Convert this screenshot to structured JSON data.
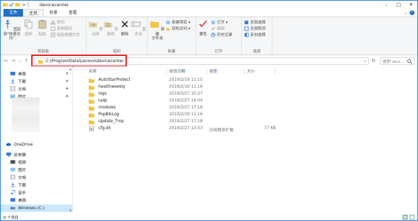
{
  "window": {
    "title": "devicecenter"
  },
  "tabs": [
    "文件",
    "主页",
    "共享",
    "查看"
  ],
  "ribbon": {
    "clipboard": {
      "label": "剪贴板",
      "pin": "固定到\"快速访问\"",
      "copy": "复制",
      "paste": "粘贴",
      "cut": "剪切",
      "copy_path": "复制路径",
      "paste_shortcut": "粘贴快捷方式"
    },
    "organize": {
      "label": "组织",
      "move_to": "移动到",
      "copy_to": "复制到",
      "delete": "删除",
      "rename": "重命名"
    },
    "new": {
      "label": "新建",
      "new_folder": "新建\n文件夹",
      "new_item": "新建项目 ▾",
      "easy_access": "轻松访问 ▾"
    },
    "open": {
      "label": "打开",
      "properties": "属性",
      "open": "打开 ▾",
      "edit": "编辑",
      "history": "历史记录"
    },
    "select": {
      "label": "选择",
      "select_all": "全部选择",
      "select_none": "全部取消",
      "invert": "反向选择"
    }
  },
  "address": {
    "path": "C:\\ProgramData\\Lenovo\\devicecenter",
    "search_placeholder": "搜索\"devi..."
  },
  "nav": {
    "quick": [
      {
        "label": "桌面",
        "pinned": true
      },
      {
        "label": "下载",
        "pinned": true
      },
      {
        "label": "文档",
        "pinned": true
      },
      {
        "label": "图片",
        "pinned": true
      }
    ],
    "onedrive": "OneDrive",
    "this_pc": "此电脑",
    "pc_items": [
      "视频",
      "图片",
      "文档",
      "下载",
      "音乐",
      "桌面"
    ],
    "drive": "Windows (C:)"
  },
  "columns": {
    "name": "名称",
    "date": "修改日期",
    "type": "类型",
    "size": "大小"
  },
  "files": [
    {
      "name": "AutoStarProtect",
      "date": "2019/2/19 11:15",
      "type": "",
      "size": "",
      "kind": "folder"
    },
    {
      "name": "healthweekly",
      "date": "2019/2/19 11:16",
      "type": "",
      "size": "",
      "kind": "folder"
    },
    {
      "name": "logs",
      "date": "2019/2/27 10:27",
      "type": "",
      "size": "",
      "kind": "folder"
    },
    {
      "name": "ludp",
      "date": "2019/2/27 14:04",
      "type": "",
      "size": "",
      "kind": "folder"
    },
    {
      "name": "modules",
      "date": "2019/2/27 17:18",
      "type": "",
      "size": "",
      "kind": "folder"
    },
    {
      "name": "PopBlkLog",
      "date": "2019/2/19 11:16",
      "type": "",
      "size": "",
      "kind": "folder"
    },
    {
      "name": "Update_Tmp",
      "date": "2019/2/27 17:18",
      "type": "",
      "size": "",
      "kind": "folder"
    },
    {
      "name": "cfg.dll",
      "date": "2019/2/27 13:53",
      "type": "应用程序扩展",
      "size": "77 KB",
      "kind": "file"
    }
  ],
  "status": {
    "count": "8 个项目"
  },
  "colors": {
    "accent": "#1f6fc5",
    "folder": "#f4c542",
    "highlight": "#e02020"
  }
}
